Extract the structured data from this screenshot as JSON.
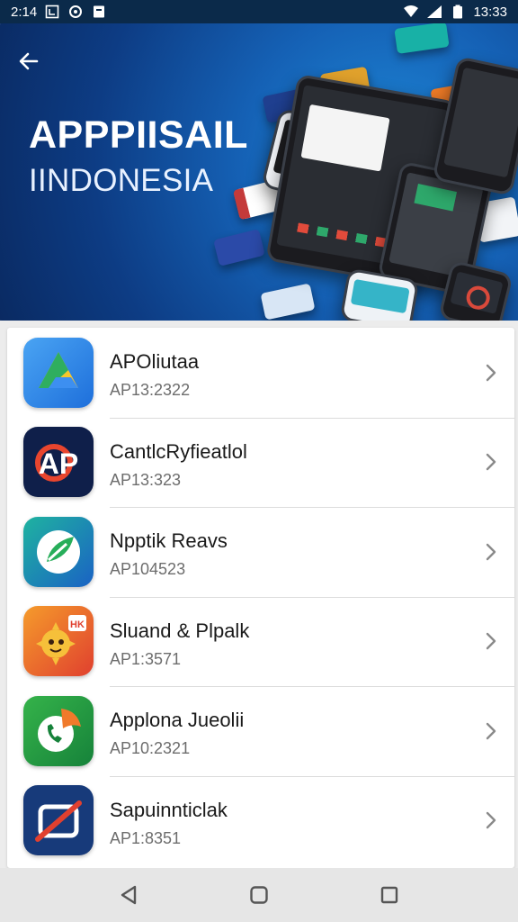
{
  "status_bar": {
    "time_left": "2:14",
    "time_right": "13:33"
  },
  "header": {
    "title": "APPPIISAIL",
    "subtitle": "IINDONESIA"
  },
  "apps": [
    {
      "name": "APOliutaa",
      "code": "AP13:2322",
      "icon": "drive-triangle-icon"
    },
    {
      "name": "CantlcRyfieatlol",
      "code": "AP13:323",
      "icon": "ap-letters-icon"
    },
    {
      "name": "Npptik Reavs",
      "code": "AP104523",
      "icon": "leaf-arrow-icon"
    },
    {
      "name": "Sluand & Plpalk",
      "code": "AP1:3571",
      "icon": "sun-creature-icon"
    },
    {
      "name": "Applona Jueolii",
      "code": "AP10:2321",
      "icon": "phone-call-icon"
    },
    {
      "name": "Sapuinnticlak",
      "code": "AP1:8351",
      "icon": "blocked-camera-icon"
    }
  ],
  "colors": {
    "status_bar": "#0b2a4a",
    "banner": "#1561b5",
    "list_background": "#ffffff",
    "nav_bar": "#e6e6e6"
  }
}
